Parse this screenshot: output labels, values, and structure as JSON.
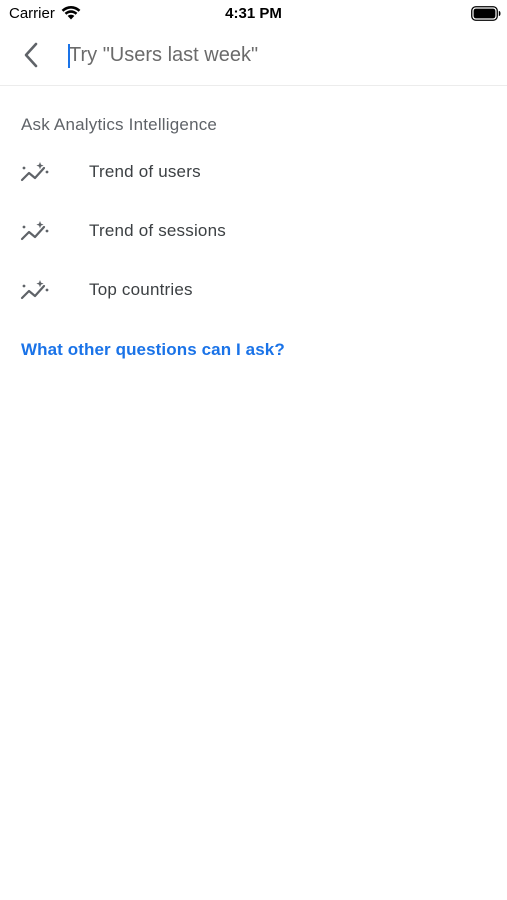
{
  "status_bar": {
    "carrier": "Carrier",
    "time": "4:31 PM"
  },
  "search": {
    "placeholder": "Try \"Users last week\"",
    "value": "",
    "back_icon": "chevron-left-icon"
  },
  "section": {
    "title": "Ask Analytics Intelligence"
  },
  "suggestions": [
    {
      "label": "Trend of users",
      "icon": "insights-icon"
    },
    {
      "label": "Trend of sessions",
      "icon": "insights-icon"
    },
    {
      "label": "Top countries",
      "icon": "insights-icon"
    }
  ],
  "help_link": {
    "label": "What other questions can I ask?"
  },
  "colors": {
    "accent": "#1a73e8",
    "secondary_text": "#5f6368",
    "primary_text": "#3c4043",
    "icon": "#5f6368"
  }
}
